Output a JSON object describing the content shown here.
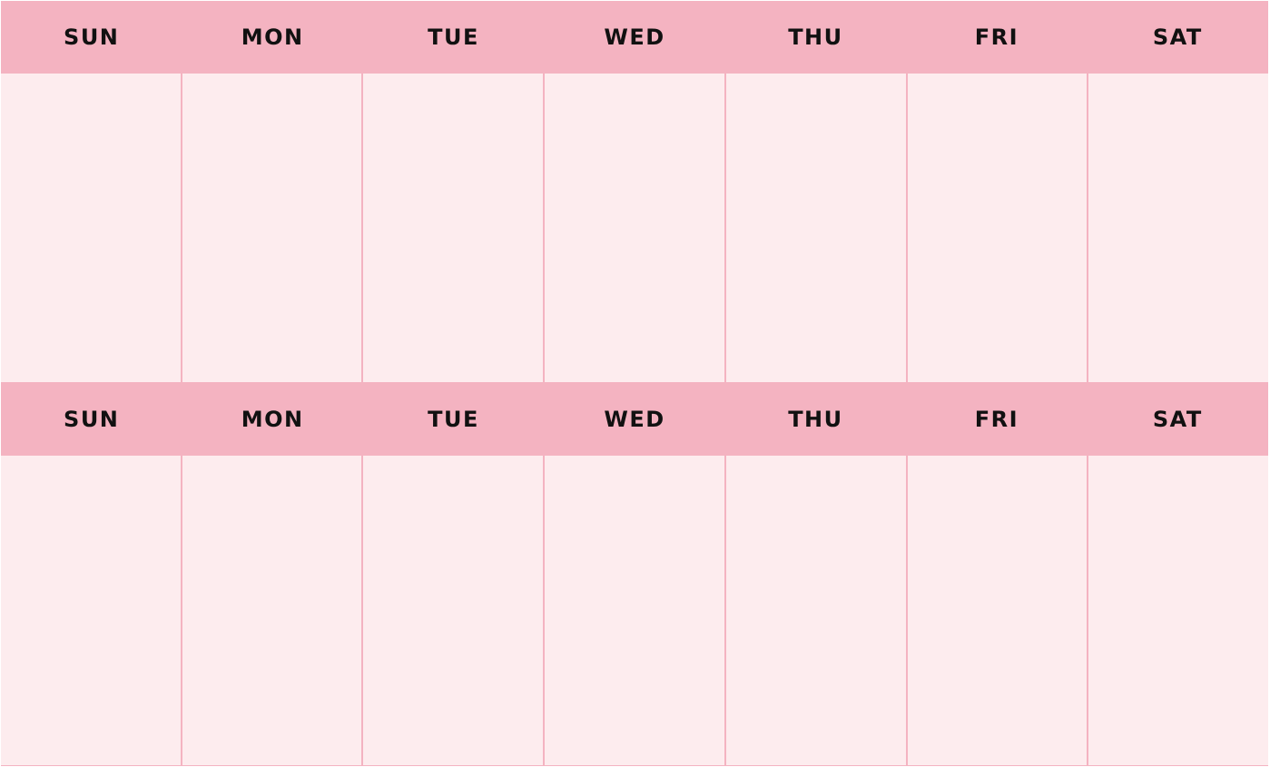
{
  "weeks": [
    {
      "days": [
        {
          "label": "SUN"
        },
        {
          "label": "MON"
        },
        {
          "label": "TUE"
        },
        {
          "label": "WED"
        },
        {
          "label": "THU"
        },
        {
          "label": "FRI"
        },
        {
          "label": "SAT"
        }
      ]
    },
    {
      "days": [
        {
          "label": "SUN"
        },
        {
          "label": "MON"
        },
        {
          "label": "TUE"
        },
        {
          "label": "WED"
        },
        {
          "label": "THU"
        },
        {
          "label": "FRI"
        },
        {
          "label": "SAT"
        }
      ]
    }
  ],
  "colors": {
    "header_background": "#f4b3c1",
    "cell_background": "#fdecee",
    "grid_line": "#f4b3c1",
    "label_text": "#111111"
  }
}
